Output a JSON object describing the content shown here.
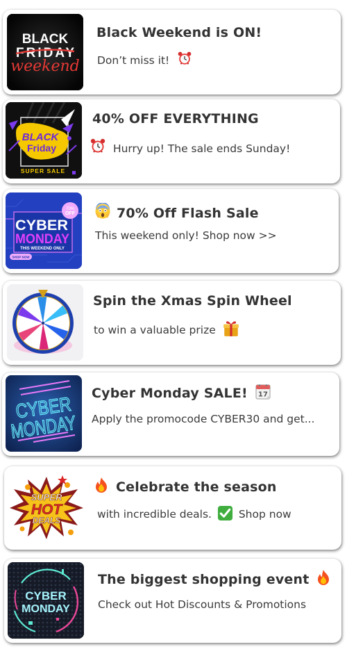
{
  "notifications": [
    {
      "image": "black-friday-weekend-banner",
      "image_text": [
        "BLACK",
        "FRIDAY",
        "weekend"
      ],
      "title": "Black Weekend is  ON!",
      "title_icon": "",
      "subtitle": "Don’t miss it!",
      "subtitle_icon": "alarm-clock-icon"
    },
    {
      "image": "black-friday-super-sale-banner",
      "image_text": [
        "BLACK",
        "Friday",
        "SUPER SALE"
      ],
      "title": "40% OFF EVERYTHING",
      "title_icon": "",
      "subtitle": "Hurry up! The sale ends Sunday!",
      "subtitle_icon_before": "alarm-clock-icon"
    },
    {
      "image": "cyber-monday-this-weekend-banner",
      "image_text": [
        "CYBER",
        "MONDAY",
        "THIS WEEKEND ONLY",
        "SHOP NOW",
        "70% OFF"
      ],
      "title": "70% Off Flash Sale",
      "title_icon_before": "screaming-face-icon",
      "subtitle": "This weekend only! Shop now >>"
    },
    {
      "image": "spin-wheel-image",
      "title": "Spin the Xmas Spin Wheel",
      "subtitle": "to win a valuable prize",
      "subtitle_icon": "gift-icon"
    },
    {
      "image": "cyber-monday-neon-banner",
      "image_text": [
        "CYBER",
        "MONDAY"
      ],
      "title": "Cyber Monday SALE!",
      "title_icon": "calendar-icon",
      "calendar_day": "17",
      "subtitle": "Apply the promocode CYBER30 and get..."
    },
    {
      "image": "super-hot-deals-banner",
      "image_text": [
        "SUPER",
        "HOT",
        "DEALS"
      ],
      "title": "Celebrate the season",
      "title_icon_before": "fire-icon",
      "subtitle_before": "with incredible deals.",
      "subtitle_icon": "check-mark-icon",
      "subtitle_after": "Shop now"
    },
    {
      "image": "cyber-monday-circle-banner",
      "image_text": [
        "CYBER",
        "MONDAY"
      ],
      "title": "The biggest shopping event",
      "title_icon": "fire-icon",
      "subtitle": "Check out Hot Discounts & Promotions"
    }
  ],
  "colors": {
    "title": "#333333",
    "subtitle": "#3a3a3a",
    "card_bg": "#ffffff"
  }
}
